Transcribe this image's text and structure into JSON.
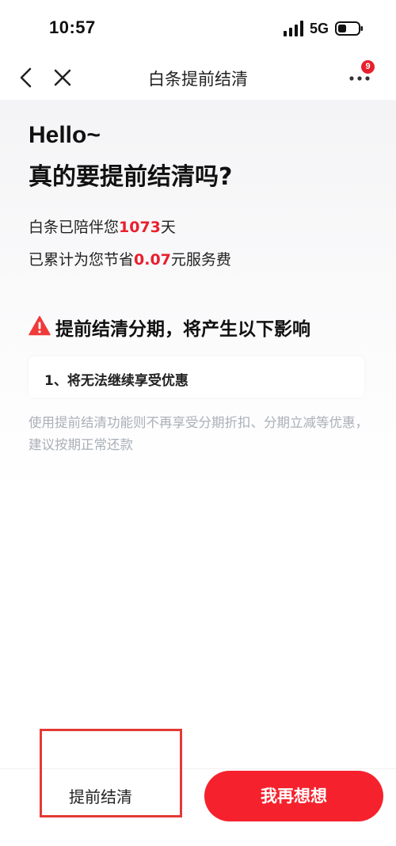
{
  "status_bar": {
    "time": "10:57",
    "network": "5G"
  },
  "nav": {
    "title": "白条提前结清",
    "badge_count": "9"
  },
  "main": {
    "greeting": "Hello~",
    "question": "真的要提前结清吗?",
    "companion_prefix": "白条已陪伴您",
    "companion_days": "1073",
    "companion_suffix": "天",
    "saving_prefix": "已累计为您节省",
    "saving_amount": "0.07",
    "saving_suffix": "元服务费",
    "warning_title": "提前结清分期，将产生以下影响",
    "impacts": [
      "1、将无法继续享受优惠"
    ],
    "description": "使用提前结清功能则不再享受分期折扣、分期立减等优惠，建议按期正常还款"
  },
  "actions": {
    "settle_label": "提前结清",
    "rethink_label": "我再想想"
  },
  "colors": {
    "accent": "#f5222d",
    "highlight": "#e8202e",
    "muted_text": "#a9b0b8"
  }
}
